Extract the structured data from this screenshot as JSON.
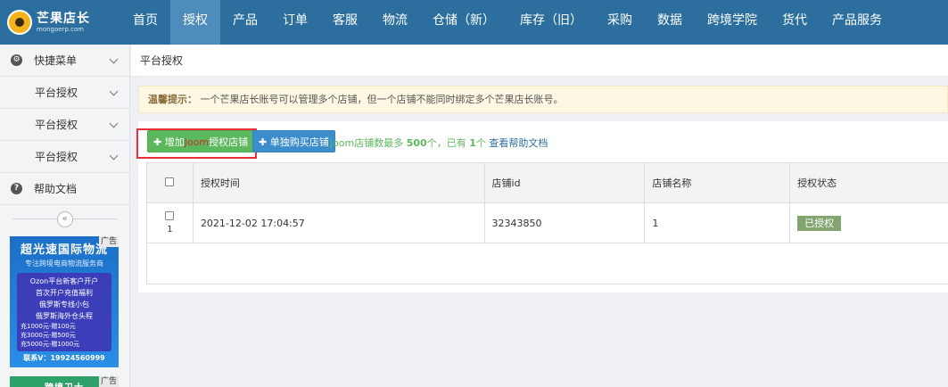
{
  "brand": {
    "title": "芒果店长",
    "subtitle": "mongoerp.com"
  },
  "nav": [
    "首页",
    "授权",
    "产品",
    "订单",
    "客服",
    "物流",
    "仓储（新）",
    "库存（旧）",
    "采购",
    "数据",
    "跨境学院",
    "货代",
    "产品服务"
  ],
  "nav_active": "授权",
  "sidebar": {
    "quick_menu": "快捷菜单",
    "items": [
      "平台授权",
      "平台授权",
      "平台授权"
    ],
    "help": "帮助文档",
    "collapse": "«"
  },
  "ads": {
    "tag": "广告",
    "ad1": {
      "title": "超光速国际物流",
      "subtitle": "专注跨境电商物流服务商",
      "lines": [
        "Ozon平台新客户开户",
        "首次开户充值福利",
        "俄罗斯专线小包",
        "俄罗斯海外仓头程"
      ],
      "prices": [
        "充1000元-赠100元",
        "充3000元-赠500元",
        "充5000元-赠1000元"
      ],
      "contact": "联系V：19924560999"
    },
    "ad2": {
      "title": "跨境卫士"
    }
  },
  "breadcrumb": "平台授权",
  "notice": {
    "label": "温馨提示：",
    "text": "一个芒果店长账号可以管理多个店铺，但一个店铺不能同时绑定多个芒果店长账号。"
  },
  "toolbar": {
    "add_prefix": "增加",
    "add_platform": "Joom",
    "add_suffix": "授权店铺",
    "buy_label": "单独购买店铺",
    "info_prefix": "joom店铺数最多 ",
    "info_max": "500",
    "info_mid": "个，已有 ",
    "info_have": "1",
    "info_unit": "个 ",
    "help_link": "查看帮助文档"
  },
  "table": {
    "headers": [
      "授权时间",
      "店铺id",
      "店铺名称",
      "授权状态"
    ],
    "rows": [
      {
        "num": "1",
        "time": "2021-12-02 17:04:57",
        "shop_id": "32343850",
        "shop_name": "1",
        "status": "已授权"
      }
    ]
  },
  "colors": {
    "nav_bg": "#2c6f9e",
    "nav_active": "#4e8cbb",
    "add_btn": "#5cb85c",
    "buy_btn": "#3c8dcc",
    "status_badge": "#82a56f",
    "highlight": "#e8303a"
  }
}
